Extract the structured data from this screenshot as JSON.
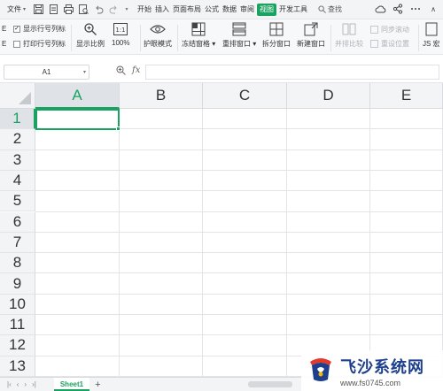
{
  "menu": {
    "file_label": "文件",
    "tabs": [
      {
        "label": "开始",
        "active": false
      },
      {
        "label": "插入",
        "active": false
      },
      {
        "label": "页面布局",
        "active": false
      },
      {
        "label": "公式",
        "active": false
      },
      {
        "label": "数据",
        "active": false
      },
      {
        "label": "审阅",
        "active": false
      },
      {
        "label": "视图",
        "active": true
      },
      {
        "label": "开发工具",
        "active": false
      }
    ],
    "search_label": "查找"
  },
  "ribbon": {
    "edge_top": "E",
    "edge_bottom": "E",
    "show_row_col_headers": {
      "label": "显示行号列标",
      "checked": true
    },
    "print_row_col_headers": {
      "label": "打印行号列标",
      "checked": false
    },
    "zoom_label": "显示比例",
    "zoom100_label": "100%",
    "eye_protection_label": "护眼模式",
    "freeze_label": "冻结窗格",
    "arrange_label": "重排窗口",
    "split_label": "拆分窗口",
    "new_window_label": "新建窗口",
    "compare_label": "并排比较",
    "sync_scroll_label": "同步滚动",
    "reset_position_label": "重设位置",
    "js_label": "JS 宏"
  },
  "formula_bar": {
    "name_box": "A1",
    "fx_label": "fx",
    "formula": ""
  },
  "grid": {
    "columns": [
      "A",
      "B",
      "C",
      "D",
      "E"
    ],
    "rows": [
      "1",
      "2",
      "3",
      "4",
      "5",
      "6",
      "7",
      "8",
      "9",
      "10",
      "11",
      "12",
      "13"
    ],
    "selected_cell": "A1"
  },
  "sheets": {
    "tabs": [
      "Sheet1"
    ],
    "active": "Sheet1",
    "add_label": "+"
  },
  "watermark": {
    "title": "飞沙系统网",
    "url": "www.fs0745.com"
  },
  "colors": {
    "accent": "#1aa260",
    "watermark_blue": "#1d3f8c"
  }
}
